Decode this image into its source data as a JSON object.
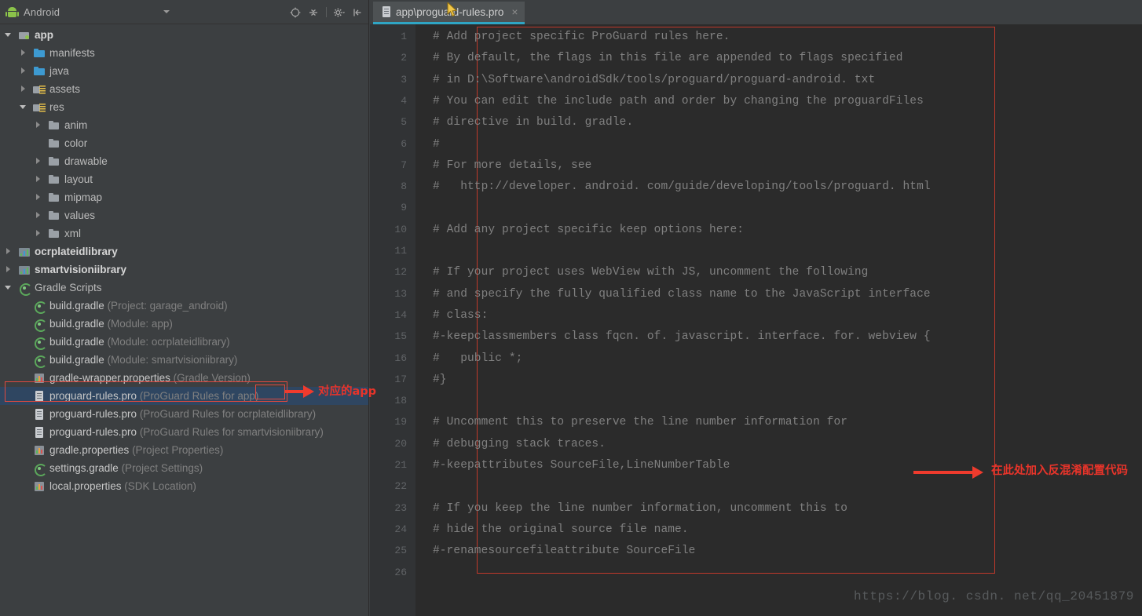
{
  "panel": {
    "title": "Android",
    "android_icon": "android-robot-icon",
    "dropdown_icon": "chevron-down-icon",
    "tools": [
      {
        "name": "locate-target-icon",
        "label": ""
      },
      {
        "name": "collapse-all-icon",
        "label": ""
      },
      {
        "name": "settings-gear-icon",
        "label": ""
      },
      {
        "name": "hide-panel-icon",
        "label": ""
      }
    ]
  },
  "tree": [
    {
      "indent": 0,
      "arrow": "down",
      "icon": "fold-app",
      "label": "app",
      "sub": "",
      "bold": true,
      "selected": false
    },
    {
      "indent": 1,
      "arrow": "right",
      "icon": "fold-blue",
      "label": "manifests",
      "sub": "",
      "bold": false,
      "selected": false
    },
    {
      "indent": 1,
      "arrow": "right",
      "icon": "fold-blue",
      "label": "java",
      "sub": "",
      "bold": false,
      "selected": false
    },
    {
      "indent": 1,
      "arrow": "right",
      "icon": "fold-res",
      "label": "assets",
      "sub": "",
      "bold": false,
      "selected": false
    },
    {
      "indent": 1,
      "arrow": "down",
      "icon": "fold-res",
      "label": "res",
      "sub": "",
      "bold": false,
      "selected": false
    },
    {
      "indent": 2,
      "arrow": "right",
      "icon": "fold-gray",
      "label": "anim",
      "sub": "",
      "bold": false,
      "selected": false
    },
    {
      "indent": 2,
      "arrow": "none",
      "icon": "fold-gray",
      "label": "color",
      "sub": "",
      "bold": false,
      "selected": false
    },
    {
      "indent": 2,
      "arrow": "right",
      "icon": "fold-gray",
      "label": "drawable",
      "sub": "",
      "bold": false,
      "selected": false
    },
    {
      "indent": 2,
      "arrow": "right",
      "icon": "fold-gray",
      "label": "layout",
      "sub": "",
      "bold": false,
      "selected": false
    },
    {
      "indent": 2,
      "arrow": "right",
      "icon": "fold-gray",
      "label": "mipmap",
      "sub": "",
      "bold": false,
      "selected": false
    },
    {
      "indent": 2,
      "arrow": "right",
      "icon": "fold-gray",
      "label": "values",
      "sub": "",
      "bold": false,
      "selected": false
    },
    {
      "indent": 2,
      "arrow": "right",
      "icon": "fold-gray",
      "label": "xml",
      "sub": "",
      "bold": false,
      "selected": false
    },
    {
      "indent": 0,
      "arrow": "right",
      "icon": "mod-ico",
      "label": "ocrplateidlibrary",
      "sub": "",
      "bold": true,
      "selected": false
    },
    {
      "indent": 0,
      "arrow": "right",
      "icon": "mod-ico",
      "label": "smartvisioniibrary",
      "sub": "",
      "bold": true,
      "selected": false
    },
    {
      "indent": 0,
      "arrow": "down",
      "icon": "gradle-ico",
      "label": "Gradle Scripts",
      "sub": "",
      "bold": false,
      "selected": false
    },
    {
      "indent": 1,
      "arrow": "none",
      "icon": "gradle-ico",
      "label": "build.gradle",
      "sub": "(Project: garage_android)",
      "bold": false,
      "selected": false
    },
    {
      "indent": 1,
      "arrow": "none",
      "icon": "gradle-ico",
      "label": "build.gradle",
      "sub": "(Module: app)",
      "bold": false,
      "selected": false
    },
    {
      "indent": 1,
      "arrow": "none",
      "icon": "gradle-ico",
      "label": "build.gradle",
      "sub": "(Module: ocrplateidlibrary)",
      "bold": false,
      "selected": false
    },
    {
      "indent": 1,
      "arrow": "none",
      "icon": "gradle-ico",
      "label": "build.gradle",
      "sub": "(Module: smartvisioniibrary)",
      "bold": false,
      "selected": false
    },
    {
      "indent": 1,
      "arrow": "none",
      "icon": "prop-ico",
      "label": "gradle-wrapper.properties",
      "sub": "(Gradle Version)",
      "bold": false,
      "selected": false
    },
    {
      "indent": 1,
      "arrow": "none",
      "icon": "doc-ico",
      "label": "proguard-rules.pro",
      "sub": "(ProGuard Rules for app)",
      "bold": false,
      "selected": true
    },
    {
      "indent": 1,
      "arrow": "none",
      "icon": "doc-ico",
      "label": "proguard-rules.pro",
      "sub": "(ProGuard Rules for ocrplateidlibrary)",
      "bold": false,
      "selected": false
    },
    {
      "indent": 1,
      "arrow": "none",
      "icon": "doc-ico",
      "label": "proguard-rules.pro",
      "sub": "(ProGuard Rules for smartvisioniibrary)",
      "bold": false,
      "selected": false
    },
    {
      "indent": 1,
      "arrow": "none",
      "icon": "prop-ico",
      "label": "gradle.properties",
      "sub": "(Project Properties)",
      "bold": false,
      "selected": false
    },
    {
      "indent": 1,
      "arrow": "none",
      "icon": "gradle-ico",
      "label": "settings.gradle",
      "sub": "(Project Settings)",
      "bold": false,
      "selected": false
    },
    {
      "indent": 1,
      "arrow": "none",
      "icon": "prop-ico",
      "label": "local.properties",
      "sub": "(SDK Location)",
      "bold": false,
      "selected": false
    }
  ],
  "editor": {
    "tab_label": "app\\proguard-rules.pro",
    "tab_close_glyph": "×",
    "tab_icon": "file-document-icon",
    "first_line": 1,
    "last_line": 26,
    "lines": [
      "# Add project specific ProGuard rules here.",
      "# By default, the flags in this file are appended to flags specified",
      "# in D:\\Software\\androidSdk/tools/proguard/proguard-android. txt",
      "# You can edit the include path and order by changing the proguardFiles",
      "# directive in build. gradle.",
      "#",
      "# For more details, see",
      "#   http://developer. android. com/guide/developing/tools/proguard. html",
      "",
      "# Add any project specific keep options here:",
      "",
      "# If your project uses WebView with JS, uncomment the following",
      "# and specify the fully qualified class name to the JavaScript interface",
      "# class:",
      "#-keepclassmembers class fqcn. of. javascript. interface. for. webview {",
      "#   public *;",
      "#}",
      "",
      "# Uncomment this to preserve the line number information for",
      "# debugging stack traces.",
      "#-keepattributes SourceFile,LineNumberTable",
      "",
      "# If you keep the line number information, uncomment this to",
      "# hide the original source file name.",
      "#-renamesourcefileattribute SourceFile",
      ""
    ]
  },
  "annotations": {
    "app_note": "对应的app",
    "code_note": "在此处加入反混淆配置代码"
  },
  "watermark": "https://blog. csdn. net/qq_20451879",
  "colors": {
    "panel_bg": "#3c3f41",
    "editor_bg": "#2b2b2b",
    "gutter_bg": "#313335",
    "selection_bg": "#2f4661",
    "tab_accent": "#2fa5c4",
    "annotation_red": "#e8342a",
    "code_box_red": "#c0392b"
  }
}
